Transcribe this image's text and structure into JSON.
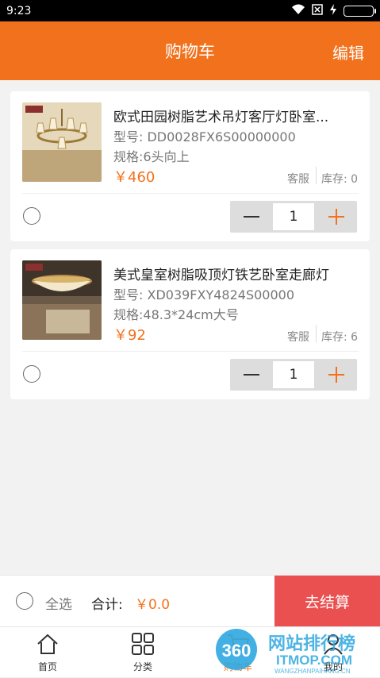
{
  "status_bar": {
    "time": "9:23",
    "icons": [
      "wifi-icon",
      "sim-x-icon",
      "charging-icon",
      "battery-icon"
    ]
  },
  "header": {
    "title": "购物车",
    "edit_label": "编辑"
  },
  "cart": {
    "items": [
      {
        "title": "欧式田园树脂艺术吊灯客厅灯卧室...",
        "model": "型号: DD0028FX6S00000000",
        "spec": "规格:6头向上",
        "price": "￥460",
        "service": "客服",
        "stock": "库存: 0",
        "quantity": "1",
        "image_icon": "chandelier-image"
      },
      {
        "title": "美式皇室树脂吸顶灯铁艺卧室走廊灯",
        "model": "型号: XD039FXY4824S00000",
        "spec": "规格:48.3*24cm大号",
        "price": "￥92",
        "service": "客服",
        "stock": "库存: 6",
        "quantity": "1",
        "image_icon": "ceiling-lamp-image"
      }
    ]
  },
  "footer": {
    "select_all": "全选",
    "total_label": "合计:",
    "total_value": "￥0.0",
    "checkout_label": "去结算"
  },
  "tabbar": {
    "tabs": [
      {
        "label": "首页",
        "icon": "home-icon"
      },
      {
        "label": "分类",
        "icon": "grid-icon"
      },
      {
        "label": "购物车",
        "icon": "cart-icon"
      },
      {
        "label": "我的",
        "icon": "user-icon"
      }
    ]
  },
  "watermark": {
    "number": "360",
    "cn": "网站排行榜",
    "en": "ITMOP.COM",
    "small": "WANGZHANPAIHANG.CN"
  },
  "colors": {
    "accent": "#f2711c",
    "checkout": "#ea5050",
    "background": "#f2f2f2"
  }
}
